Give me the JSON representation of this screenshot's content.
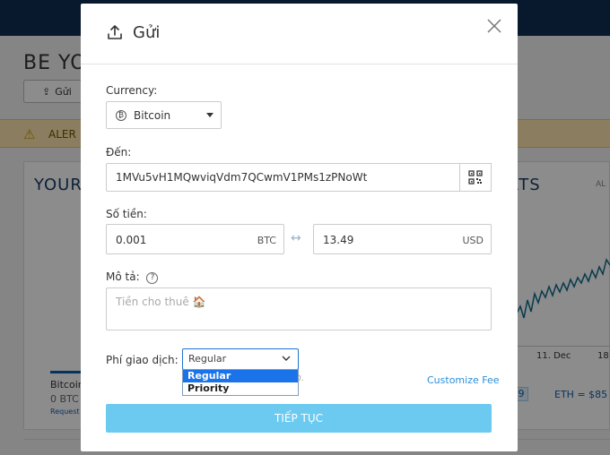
{
  "background": {
    "heading": "BE YO",
    "send_button": "Gửi",
    "alert_text": "ALER",
    "card_title_left": "YOUR",
    "card_title_right": "RTS",
    "card_all": "AL",
    "chart_ticks": [
      "11. Dec",
      "18"
    ],
    "coin_name": "Bitcoin",
    "coin_balance": "0 BTC",
    "coin_request": "Request",
    "badge": "9",
    "eth_rate": "ETH = $85"
  },
  "modal": {
    "title": "Gửi",
    "currency_label": "Currency:",
    "currency_value": "Bitcoin",
    "to_label": "Đến:",
    "to_value": "1MVu5vH1MQwviqVdm7QCwmV1PMs1zPNoWt",
    "amount_label": "Số tiền:",
    "amount_btc": "0.001",
    "amount_btc_unit": "BTC",
    "amount_usd": "13.49",
    "amount_usd_unit": "USD",
    "desc_label": "Mô tả:",
    "desc_placeholder": "Tiền cho thuê 🏠",
    "fee_label": "Phí giao dịch:",
    "fee_selected": "Regular",
    "fee_options": [
      "Regular",
      "Priority"
    ],
    "fee_hint": "0.",
    "customize_fee": "Customize Fee",
    "continue_button": "TIẾP TỤC"
  },
  "colors": {
    "accent": "#6ccaf0",
    "link": "#2c8fd6",
    "topbar": "#0f2c52"
  }
}
